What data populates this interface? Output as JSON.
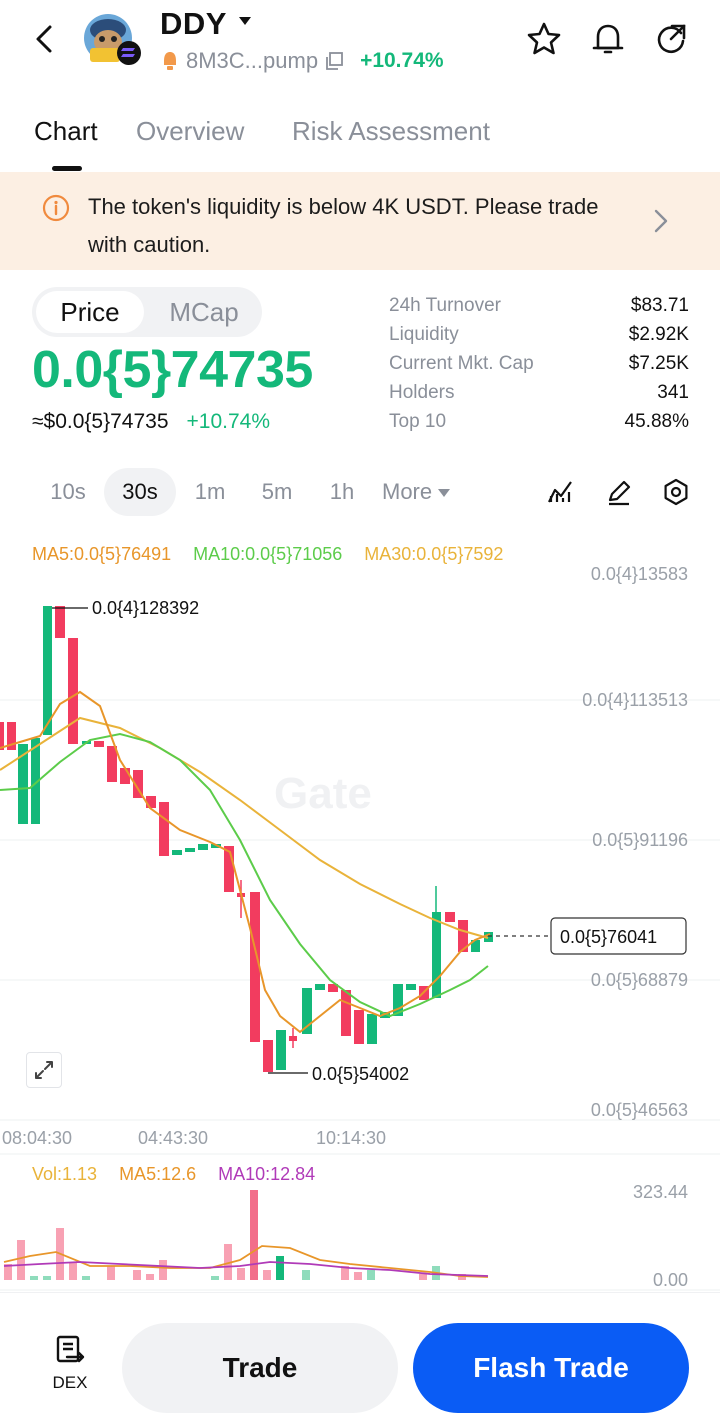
{
  "header": {
    "title": "DDY",
    "address": "8M3C...pump",
    "change": "+10.74%"
  },
  "tabs": [
    {
      "label": "Chart"
    },
    {
      "label": "Overview"
    },
    {
      "label": "Risk Assessment"
    }
  ],
  "banner": {
    "text": "The token's liquidity is below 4K USDT. Please trade with caution."
  },
  "price": {
    "toggle_price": "Price",
    "toggle_mcap": "MCap",
    "value": "0.0{5}74735",
    "usd": "≈$0.0{5}74735",
    "change": "+10.74%"
  },
  "stats": [
    {
      "label": "24h  Turnover",
      "value": "$83.71"
    },
    {
      "label": "Liquidity",
      "value": "$2.92K"
    },
    {
      "label": "Current Mkt. Cap",
      "value": "$7.25K"
    },
    {
      "label": "Holders",
      "value": "341"
    },
    {
      "label": "Top 10",
      "value": "45.88%"
    }
  ],
  "intervals": [
    "10s",
    "30s",
    "1m",
    "5m",
    "1h",
    "More"
  ],
  "chart": {
    "ma5": "MA5:0.0{5}76491",
    "ma10": "MA10:0.0{5}71056",
    "ma30": "MA30:0.0{5}7592",
    "price_axis": [
      "0.0{4}13583",
      "0.0{4}113513",
      "0.0{5}91196",
      "0.0{5}68879",
      "0.0{5}46563"
    ],
    "time_axis": [
      "08:04:30",
      "04:43:30",
      "10:14:30"
    ],
    "high_label": "0.0{4}128392",
    "low_label": "0.0{5}54002",
    "current_label": "0.0{5}76041",
    "watermark": "Gate",
    "vol": "Vol:1.13",
    "vol_ma5": "MA5:12.6",
    "vol_ma10": "MA10:12.84",
    "vol_axis": [
      "323.44",
      "0.00"
    ]
  },
  "colors": {
    "up": "#14b87a",
    "down": "#f23c5f",
    "ma5": "#e8962a",
    "ma10": "#5ccc4a",
    "ma30": "#e9b33a",
    "vol_ma10": "#b03ab8",
    "accent": "#0a5cf5"
  },
  "bottom": {
    "dex": "DEX",
    "trade": "Trade",
    "flash_trade": "Flash Trade"
  }
}
